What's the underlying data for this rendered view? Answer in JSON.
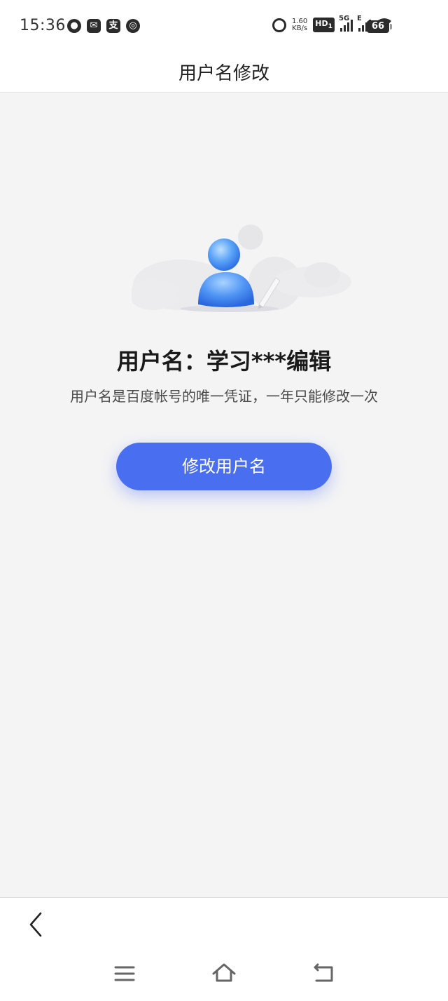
{
  "status_bar": {
    "time": "15:36",
    "app_icons": [
      "message-icon",
      "mail-icon",
      "alipay-icon",
      "bank-icon"
    ],
    "alipay_glyph": "支",
    "net_speed_value": "1.60",
    "net_speed_unit": "KB/s",
    "hd_label": "HD",
    "hd_sub": "1",
    "sim1_label": "5G",
    "sim2_label": "E",
    "battery": "66"
  },
  "header": {
    "title": "用户名修改"
  },
  "profile": {
    "username_line": "用户名：学习***编辑",
    "description": "用户名是百度帐号的唯一凭证，一年只能修改一次",
    "edit_button_label": "修改用户名"
  },
  "colors": {
    "accent": "#4a6ef0",
    "background": "#f4f4f5"
  }
}
